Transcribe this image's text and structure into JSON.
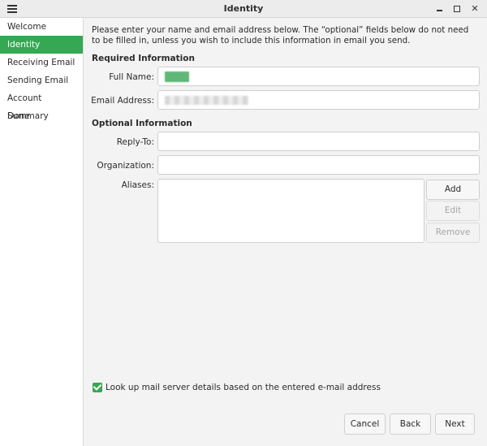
{
  "window": {
    "title": "Identity"
  },
  "sidebar": {
    "items": [
      {
        "label": "Welcome"
      },
      {
        "label": "Identity"
      },
      {
        "label": "Receiving Email"
      },
      {
        "label": "Sending Email"
      },
      {
        "label": "Account Summary"
      },
      {
        "label": "Done"
      }
    ],
    "active_index": 1
  },
  "intro_text": "Please enter your name and email address below. The “optional” fields below do not need to be filled in, unless you wish to include this information in email you send.",
  "required": {
    "title": "Required Information",
    "full_name_label": "Full Name:",
    "full_name_value": "",
    "email_label": "Email Address:",
    "email_value": ""
  },
  "optional": {
    "title": "Optional Information",
    "reply_to_label": "Reply-To:",
    "reply_to_value": "",
    "organization_label": "Organization:",
    "organization_value": "",
    "aliases_label": "Aliases:",
    "add_label": "Add",
    "edit_label": "Edit",
    "remove_label": "Remove"
  },
  "lookup": {
    "checked": true,
    "label": "Look up mail server details based on the entered e-mail address"
  },
  "footer": {
    "cancel_label": "Cancel",
    "back_label": "Back",
    "next_label": "Next"
  },
  "colors": {
    "accent": "#35a853"
  }
}
